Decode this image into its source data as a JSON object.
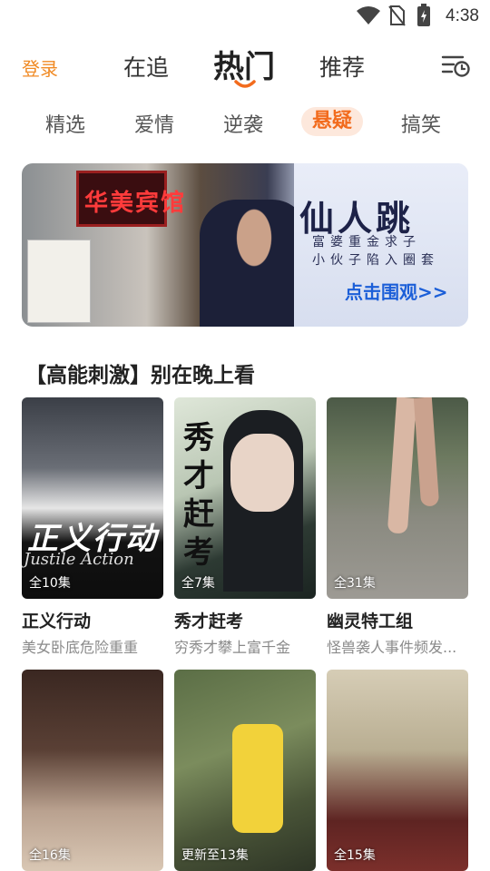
{
  "status_bar": {
    "time": "4:38"
  },
  "top_nav": {
    "login": "登录",
    "tabs": [
      {
        "label": "在追"
      },
      {
        "label": "热门"
      },
      {
        "label": "推荐"
      }
    ],
    "active_tab": "热门"
  },
  "categories": [
    {
      "label": "精选"
    },
    {
      "label": "爱情"
    },
    {
      "label": "逆袭"
    },
    {
      "label": "悬疑"
    },
    {
      "label": "搞笑"
    }
  ],
  "active_category": "悬疑",
  "banner": {
    "sign_text": "华美宾馆",
    "title": "仙人跳",
    "line1": "富婆重金求子",
    "line2": "小伙子陷入圈套",
    "cta": "点击围观>>"
  },
  "section": {
    "title": "【高能刺激】别在晚上看",
    "cards": [
      {
        "title": "正义行动",
        "subtitle": "美女卧底危险重重",
        "episodes": "全10集",
        "poster_text": "正义行动",
        "poster_eng": "Justile Action"
      },
      {
        "title": "秀才赶考",
        "subtitle": "穷秀才攀上富千金",
        "episodes": "全7集",
        "poster_text": "秀才赶考"
      },
      {
        "title": "幽灵特工组",
        "subtitle": "怪兽袭人事件频发...",
        "episodes": "全31集"
      },
      {
        "title": "",
        "subtitle": "",
        "episodes": "全16集"
      },
      {
        "title": "",
        "subtitle": "",
        "episodes": "更新至13集"
      },
      {
        "title": "",
        "subtitle": "",
        "episodes": "全15集"
      }
    ]
  },
  "colors": {
    "accent": "#f26b1d",
    "login": "#f08a24",
    "cta": "#1c5fd8"
  },
  "icons": [
    "wifi-icon",
    "no-sim-icon",
    "battery-icon",
    "watch-history-icon"
  ]
}
